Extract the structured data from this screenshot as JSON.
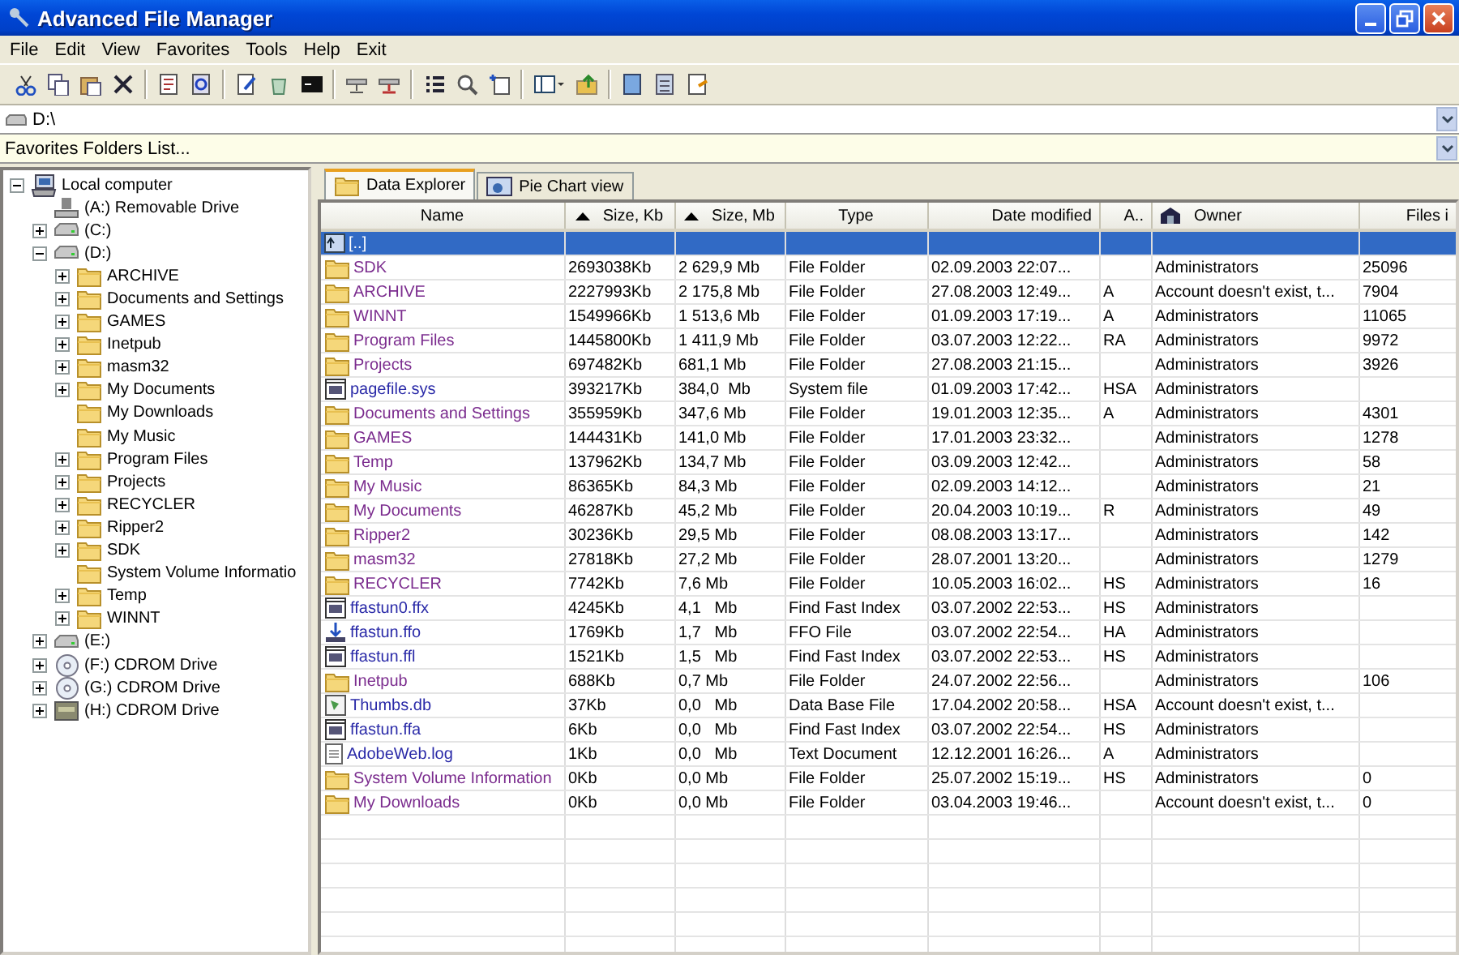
{
  "window": {
    "title": "Advanced File Manager"
  },
  "menu": [
    "File",
    "Edit",
    "View",
    "Favorites",
    "Tools",
    "Help",
    "Exit"
  ],
  "address": {
    "value": "D:\\"
  },
  "favorites": {
    "value": "Favorites Folders List..."
  },
  "tree": [
    {
      "label": "Local computer",
      "kind": "computer",
      "expandable": true,
      "expanded": true,
      "children": [
        {
          "label": "(A:)  Removable Drive",
          "kind": "floppy",
          "expandable": false
        },
        {
          "label": "(C:)",
          "kind": "drive",
          "expandable": true,
          "expanded": false
        },
        {
          "label": "(D:)",
          "kind": "drive",
          "expandable": true,
          "expanded": true,
          "children": [
            {
              "label": "ARCHIVE",
              "kind": "folder",
              "expandable": true,
              "expanded": false
            },
            {
              "label": "Documents and Settings",
              "kind": "folder",
              "expandable": true,
              "expanded": false
            },
            {
              "label": "GAMES",
              "kind": "folder",
              "expandable": true,
              "expanded": false
            },
            {
              "label": "Inetpub",
              "kind": "folder",
              "expandable": true,
              "expanded": false
            },
            {
              "label": "masm32",
              "kind": "folder",
              "expandable": true,
              "expanded": false
            },
            {
              "label": "My Documents",
              "kind": "folder",
              "expandable": true,
              "expanded": false
            },
            {
              "label": "My Downloads",
              "kind": "folder",
              "expandable": false
            },
            {
              "label": "My Music",
              "kind": "folder",
              "expandable": false
            },
            {
              "label": "Program Files",
              "kind": "folder",
              "expandable": true,
              "expanded": false
            },
            {
              "label": "Projects",
              "kind": "folder",
              "expandable": true,
              "expanded": false
            },
            {
              "label": "RECYCLER",
              "kind": "folder",
              "expandable": true,
              "expanded": false
            },
            {
              "label": "Ripper2",
              "kind": "folder",
              "expandable": true,
              "expanded": false
            },
            {
              "label": "SDK",
              "kind": "folder",
              "expandable": true,
              "expanded": false
            },
            {
              "label": "System Volume Informatio",
              "kind": "folder",
              "expandable": false
            },
            {
              "label": "Temp",
              "kind": "folder",
              "expandable": true,
              "expanded": false
            },
            {
              "label": "WINNT",
              "kind": "folder",
              "expandable": true,
              "expanded": false
            }
          ]
        },
        {
          "label": "(E:)",
          "kind": "drive",
          "expandable": true,
          "expanded": false
        },
        {
          "label": "(F:)  CDROM Drive",
          "kind": "cdrom",
          "expandable": true,
          "expanded": false
        },
        {
          "label": "(G:)  CDROM Drive",
          "kind": "cdrom",
          "expandable": true,
          "expanded": false
        },
        {
          "label": "(H:)  CDROM Drive",
          "kind": "media",
          "expandable": true,
          "expanded": false
        }
      ]
    }
  ],
  "tabs": [
    {
      "label": "Data Explorer",
      "kind": "explorer",
      "selected": true
    },
    {
      "label": "Pie Chart view",
      "kind": "chart",
      "selected": false
    }
  ],
  "columns": [
    {
      "label": "Name",
      "sort_arrow": false,
      "has_icon": false
    },
    {
      "label": "Size, Kb",
      "sort_arrow": true,
      "has_icon": false
    },
    {
      "label": "Size, Mb",
      "sort_arrow": true,
      "has_icon": false
    },
    {
      "label": "Type",
      "sort_arrow": false,
      "has_icon": false
    },
    {
      "label": "Date modified",
      "sort_arrow": false,
      "has_icon": false
    },
    {
      "label": "A..",
      "sort_arrow": false,
      "has_icon": false
    },
    {
      "label": "Owner",
      "sort_arrow": false,
      "has_icon": true
    },
    {
      "label": "Files i",
      "sort_arrow": false,
      "has_icon": false
    }
  ],
  "rows": [
    {
      "kind": "parent",
      "selected": true,
      "cells": [
        "[..]",
        "",
        "",
        "",
        "",
        "",
        "",
        ""
      ]
    },
    {
      "kind": "folder",
      "selected": false,
      "cells": [
        "SDK",
        "2693038Kb",
        "2 629,9 Mb",
        "File Folder",
        "02.09.2003 22:07...",
        "",
        "Administrators",
        "25096"
      ]
    },
    {
      "kind": "folder",
      "selected": false,
      "cells": [
        "ARCHIVE",
        "2227993Kb",
        "2 175,8 Mb",
        "File Folder",
        "27.08.2003 12:49...",
        "A",
        "Account doesn't exist, t...",
        "7904"
      ]
    },
    {
      "kind": "folder",
      "selected": false,
      "cells": [
        "WINNT",
        "1549966Kb",
        "1 513,6 Mb",
        "File Folder",
        "01.09.2003 17:19...",
        "A",
        "Administrators",
        "11065"
      ]
    },
    {
      "kind": "folder",
      "selected": false,
      "cells": [
        "Program Files",
        "1445800Kb",
        "1 411,9 Mb",
        "File Folder",
        "03.07.2003 12:22...",
        "RA",
        "Administrators",
        "9972"
      ]
    },
    {
      "kind": "folder",
      "selected": false,
      "cells": [
        "Projects",
        "697482Kb",
        "681,1 Mb",
        "File Folder",
        "27.08.2003 21:15...",
        "",
        "Administrators",
        "3926"
      ]
    },
    {
      "kind": "system",
      "selected": false,
      "cells": [
        "pagefile.sys",
        "393217Kb",
        "384,0  Mb",
        "System file",
        "01.09.2003 17:42...",
        "HSA",
        "Administrators",
        ""
      ]
    },
    {
      "kind": "folder",
      "selected": false,
      "cells": [
        "Documents and Settings",
        "355959Kb",
        "347,6 Mb",
        "File Folder",
        "19.01.2003 12:35...",
        "A",
        "Administrators",
        "4301"
      ]
    },
    {
      "kind": "folder",
      "selected": false,
      "cells": [
        "GAMES",
        "144431Kb",
        "141,0 Mb",
        "File Folder",
        "17.01.2003 23:32...",
        "",
        "Administrators",
        "1278"
      ]
    },
    {
      "kind": "folder",
      "selected": false,
      "cells": [
        "Temp",
        "137962Kb",
        "134,7 Mb",
        "File Folder",
        "03.09.2003 12:42...",
        "",
        "Administrators",
        "58"
      ]
    },
    {
      "kind": "folder",
      "selected": false,
      "cells": [
        "My Music",
        "86365Kb",
        "84,3 Mb",
        "File Folder",
        "02.09.2003 14:12...",
        "",
        "Administrators",
        "21"
      ]
    },
    {
      "kind": "folder",
      "selected": false,
      "cells": [
        "My Documents",
        "46287Kb",
        "45,2 Mb",
        "File Folder",
        "20.04.2003 10:19...",
        "R",
        "Administrators",
        "49"
      ]
    },
    {
      "kind": "folder",
      "selected": false,
      "cells": [
        "Ripper2",
        "30236Kb",
        "29,5 Mb",
        "File Folder",
        "08.08.2003 13:17...",
        "",
        "Administrators",
        "142"
      ]
    },
    {
      "kind": "folder",
      "selected": false,
      "cells": [
        "masm32",
        "27818Kb",
        "27,2 Mb",
        "File Folder",
        "28.07.2001 13:20...",
        "",
        "Administrators",
        "1279"
      ]
    },
    {
      "kind": "folder",
      "selected": false,
      "cells": [
        "RECYCLER",
        "7742Kb",
        "7,6 Mb",
        "File Folder",
        "10.05.2003 16:02...",
        "HS",
        "Administrators",
        "16"
      ]
    },
    {
      "kind": "system",
      "selected": false,
      "cells": [
        "ffastun0.ffx",
        "4245Kb",
        "4,1   Mb",
        "Find Fast Index",
        "03.07.2002 22:53...",
        "HS",
        "Administrators",
        ""
      ]
    },
    {
      "kind": "download",
      "selected": false,
      "cells": [
        "ffastun.ffo",
        "1769Kb",
        "1,7   Mb",
        "FFO File",
        "03.07.2002 22:54...",
        "HA",
        "Administrators",
        ""
      ]
    },
    {
      "kind": "system",
      "selected": false,
      "cells": [
        "ffastun.ffl",
        "1521Kb",
        "1,5   Mb",
        "Find Fast Index",
        "03.07.2002 22:53...",
        "HS",
        "Administrators",
        ""
      ]
    },
    {
      "kind": "folder",
      "selected": false,
      "cells": [
        "Inetpub",
        "688Kb",
        "0,7 Mb",
        "File Folder",
        "24.07.2002 22:56...",
        "",
        "Administrators",
        "106"
      ]
    },
    {
      "kind": "database",
      "selected": false,
      "cells": [
        "Thumbs.db",
        "37Kb",
        "0,0   Mb",
        "Data Base File",
        "17.04.2002 20:58...",
        "HSA",
        "Account doesn't exist, t...",
        ""
      ]
    },
    {
      "kind": "system",
      "selected": false,
      "cells": [
        "ffastun.ffa",
        "6Kb",
        "0,0   Mb",
        "Find Fast Index",
        "03.07.2002 22:54...",
        "HS",
        "Administrators",
        ""
      ]
    },
    {
      "kind": "text",
      "selected": false,
      "cells": [
        "AdobeWeb.log",
        "1Kb",
        "0,0   Mb",
        "Text Document",
        "12.12.2001 16:26...",
        "A",
        "Administrators",
        ""
      ]
    },
    {
      "kind": "folder",
      "selected": false,
      "cells": [
        "System Volume Information",
        "0Kb",
        "0,0 Mb",
        "File Folder",
        "25.07.2002 15:19...",
        "HS",
        "Administrators",
        "0"
      ]
    },
    {
      "kind": "folder",
      "selected": false,
      "cells": [
        "My Downloads",
        "0Kb",
        "0,0 Mb",
        "File Folder",
        "03.04.2003 19:46...",
        "",
        "Account doesn't exist, t...",
        "0"
      ]
    }
  ]
}
